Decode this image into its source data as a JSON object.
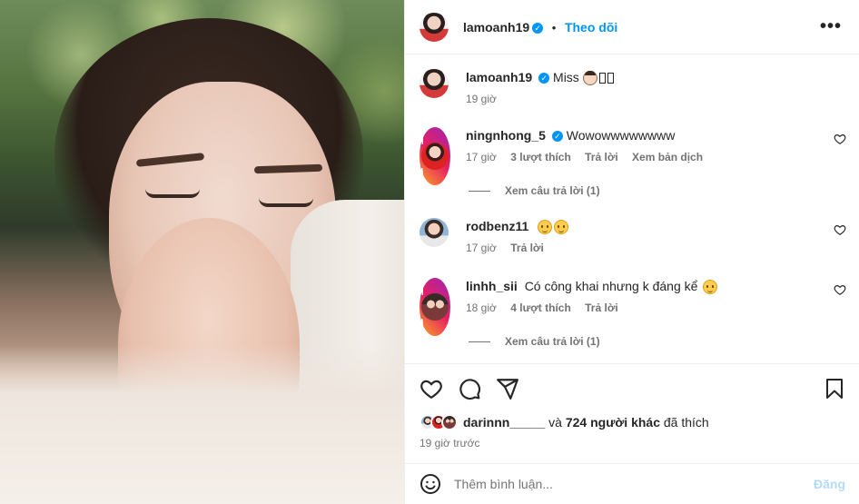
{
  "post": {
    "author": "lamoanh19",
    "follow_label": "Theo dõi",
    "separator": "•",
    "more_label": "•••",
    "caption": {
      "username": "lamoanh19",
      "text": "Miss",
      "time": "19 giờ"
    }
  },
  "comments": [
    {
      "username": "ningnhong_5",
      "verified": true,
      "text": "Wowowwwwwwww",
      "time": "17 giờ",
      "likes": "3 lượt thích",
      "reply_label": "Trả lời",
      "translate_label": "Xem bản dịch",
      "view_replies": "Xem câu trả lời (1)"
    },
    {
      "username": "rodbenz11",
      "verified": false,
      "text": "",
      "time": "17 giờ",
      "reply_label": "Trả lời"
    },
    {
      "username": "linhh_sii",
      "verified": false,
      "text": "Có công khai nhưng k đáng kể",
      "time": "18 giờ",
      "likes": "4 lượt thích",
      "reply_label": "Trả lời",
      "view_replies": "Xem câu trả lời (1)"
    }
  ],
  "likes_line": {
    "liker": "darinnn_____",
    "and": "và",
    "others": "724 người khác",
    "suffix": "đã thích"
  },
  "timestamp": "19 giờ trước",
  "add_comment": {
    "placeholder": "Thêm bình luận...",
    "post_label": "Đăng"
  },
  "colors": {
    "accent": "#0095f6",
    "muted": "#737373",
    "text": "#262626",
    "post_disabled": "#b3dbff"
  }
}
